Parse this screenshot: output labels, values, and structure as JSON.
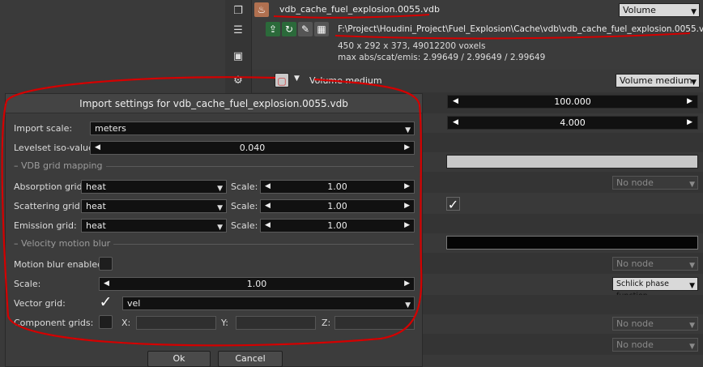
{
  "header": {
    "file_name": "vdb_cache_fuel_explosion.0055.vdb",
    "type_select": "Volume",
    "file_path": "F:\\Project\\Houdini_Project\\Fuel_Explosion\\Cache\\vdb\\vdb_cache_fuel_explosion.0055.vdb",
    "voxel_info": "450 x 292 x 373, 49012200 voxels",
    "max_info": "max abs/scat/emis: 2.99649 / 2.99649 / 2.99649"
  },
  "medium": {
    "label": "Volume medium",
    "select": "Volume medium"
  },
  "background_params": {
    "slider1_value": "100.000",
    "slider2_value": "4.000",
    "node1": "No node",
    "node2": "No node",
    "phase_function": "Schlick phase function",
    "node3": "No node",
    "node4": "No node"
  },
  "dialog": {
    "title": "Import settings for vdb_cache_fuel_explosion.0055.vdb",
    "import_scale_label": "Import scale:",
    "import_scale_value": "meters",
    "levelset_label": "Levelset iso-value:",
    "levelset_value": "0.040",
    "vdb_section": "VDB grid mapping",
    "absorption_label": "Absorption grid:",
    "absorption_value": "heat",
    "absorption_scale": "1.00",
    "scattering_label": "Scattering grid:",
    "scattering_value": "heat",
    "scattering_scale": "1.00",
    "emission_label": "Emission grid:",
    "emission_value": "heat",
    "emission_scale": "1.00",
    "scale_label": "Scale:",
    "velocity_section": "Velocity motion blur",
    "motion_blur_label": "Motion blur enabled:",
    "motion_blur_checked": false,
    "vel_scale_label": "Scale:",
    "vel_scale_value": "1.00",
    "vector_grid_label": "Vector grid:",
    "vector_grid_checked": true,
    "vector_grid_value": "vel",
    "component_label": "Component grids:",
    "component_x_label": "X:",
    "component_y_label": "Y:",
    "component_z_label": "Z:",
    "ok_label": "Ok",
    "cancel_label": "Cancel"
  },
  "annotation_color": "#d40000"
}
